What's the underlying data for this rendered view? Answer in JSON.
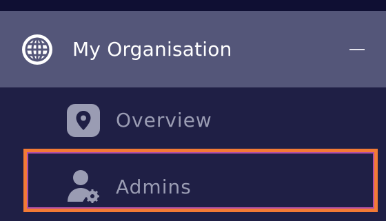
{
  "section": {
    "title": "My Organisation",
    "icon": "globe-icon",
    "collapse_icon": "minus-icon"
  },
  "nav": {
    "items": [
      {
        "label": "Overview",
        "icon": "location-pin-icon",
        "active": false
      },
      {
        "label": "Admins",
        "icon": "admin-user-gear-icon",
        "active": true
      }
    ]
  },
  "colors": {
    "background": "#1f1f45",
    "topbar": "#0f0f33",
    "section_header": "#545679",
    "text_primary": "#ffffff",
    "text_muted": "#9a9cb3",
    "highlight": "#f37a35"
  }
}
